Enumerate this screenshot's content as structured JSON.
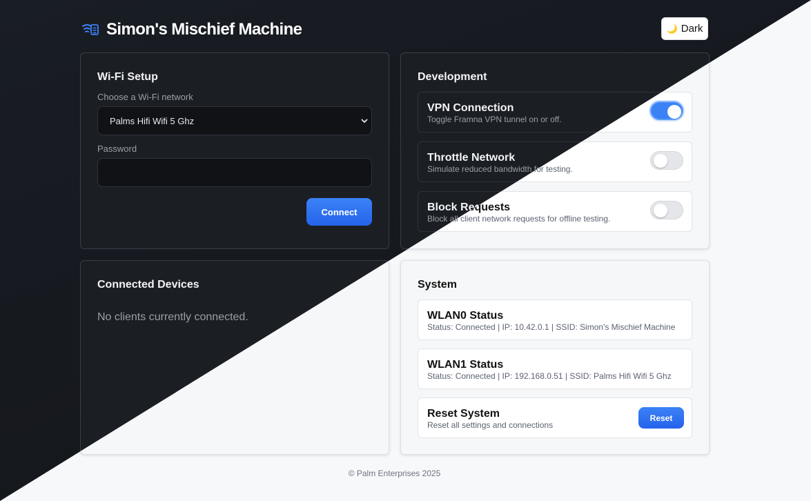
{
  "app": {
    "title": "Simon's Mischief Machine",
    "logo_icon": "wifi-server-icon"
  },
  "theme_toggle": {
    "icon": "moon-icon",
    "glyph": "🌙",
    "label": "Dark"
  },
  "wifi_setup": {
    "title": "Wi-Fi Setup",
    "network_label": "Choose a Wi-Fi network",
    "network_value": "Palms Hifi Wifi 5 Ghz",
    "password_label": "Password",
    "password_value": "",
    "connect_label": "Connect"
  },
  "development": {
    "title": "Development",
    "items": [
      {
        "title": "VPN Connection",
        "description": "Toggle Framna VPN tunnel on or off.",
        "enabled": true
      },
      {
        "title": "Throttle Network",
        "description": "Simulate reduced bandwidth for testing.",
        "enabled": false
      },
      {
        "title": "Block Requests",
        "description": "Block all client network requests for offline testing.",
        "enabled": false
      }
    ]
  },
  "connected_devices": {
    "title": "Connected Devices",
    "empty_message": "No clients currently connected."
  },
  "system": {
    "title": "System",
    "wlan0": {
      "title": "WLAN0 Status",
      "status": "Status: Connected | IP: 10.42.0.1 | SSID: Simon's Mischief Machine"
    },
    "wlan1": {
      "title": "WLAN1 Status",
      "status": "Status: Connected | IP: 192.168.0.51 | SSID: Palms Hifi Wifi 5 Ghz"
    },
    "reset": {
      "title": "Reset System",
      "description": "Reset all settings and connections",
      "button_label": "Reset"
    }
  },
  "footer": {
    "text": "© Palm Enterprises 2025"
  },
  "colors": {
    "accent": "#3b82f6",
    "dark_bg": "#16191e",
    "light_bg": "#f7f8fa"
  }
}
